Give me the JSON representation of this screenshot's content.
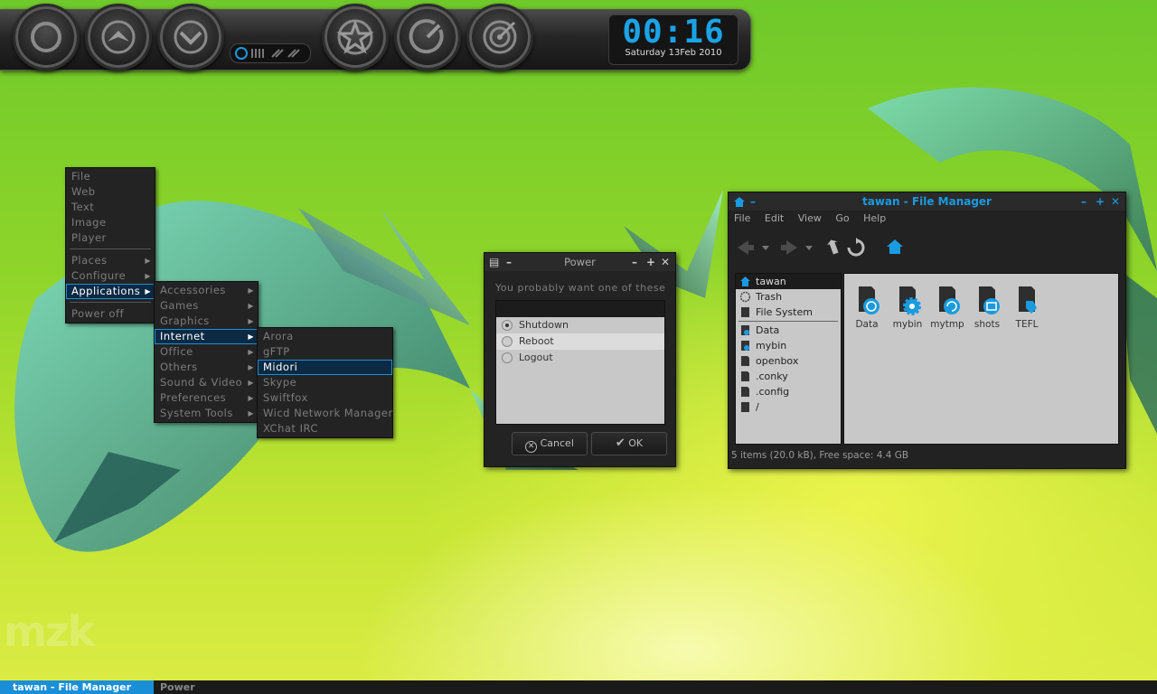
{
  "colors": {
    "accent": "#1a9be0",
    "desktop_green": "#8fd52a",
    "panel_dark": "#232323"
  },
  "clock": {
    "time": "00:16",
    "date": "Saturday 13Feb 2010"
  },
  "dock": {
    "buttons": [
      {
        "name": "ring-icon"
      },
      {
        "name": "chevron-up-icon"
      },
      {
        "name": "chevron-down-icon"
      },
      {
        "name": "star-icon"
      },
      {
        "name": "gauge-icon"
      },
      {
        "name": "target-icon"
      }
    ]
  },
  "desktop_watermark": "mzk",
  "root_menu": {
    "items": [
      "File",
      "Web",
      "Text",
      "Image",
      "Player"
    ],
    "items2": [
      "Places",
      "Configure",
      "Applications"
    ],
    "power_off": "Power off"
  },
  "applications_menu": {
    "items": [
      "Accessories",
      "Games",
      "Graphics",
      "Internet",
      "Office",
      "Others",
      "Sound & Video",
      "Preferences",
      "System Tools"
    ]
  },
  "internet_menu": {
    "items": [
      "Arora",
      "gFTP",
      "Midori",
      "Skype",
      "Swiftfox",
      "Wicd Network Manager",
      "XChat IRC"
    ]
  },
  "power_dialog": {
    "title": "Power",
    "prompt": "You probably want one of these",
    "options": [
      "Shutdown",
      "Reboot",
      "Logout"
    ],
    "cancel_label": "Cancel",
    "ok_label": "OK"
  },
  "file_manager": {
    "title": "tawan - File Manager",
    "menus": [
      "File",
      "Edit",
      "View",
      "Go",
      "Help"
    ],
    "sidebar": [
      "tawan",
      "Trash",
      "File System",
      "Data",
      "mybin",
      "openbox",
      ".conky",
      ".config",
      "/"
    ],
    "files": [
      "Data",
      "mybin",
      "mytmp",
      "shots",
      "TEFL"
    ],
    "status": "5 items (20.0 kB), Free space: 4.4 GB"
  },
  "taskbar": {
    "tasks": [
      "tawan - File Manager",
      "Power"
    ]
  }
}
